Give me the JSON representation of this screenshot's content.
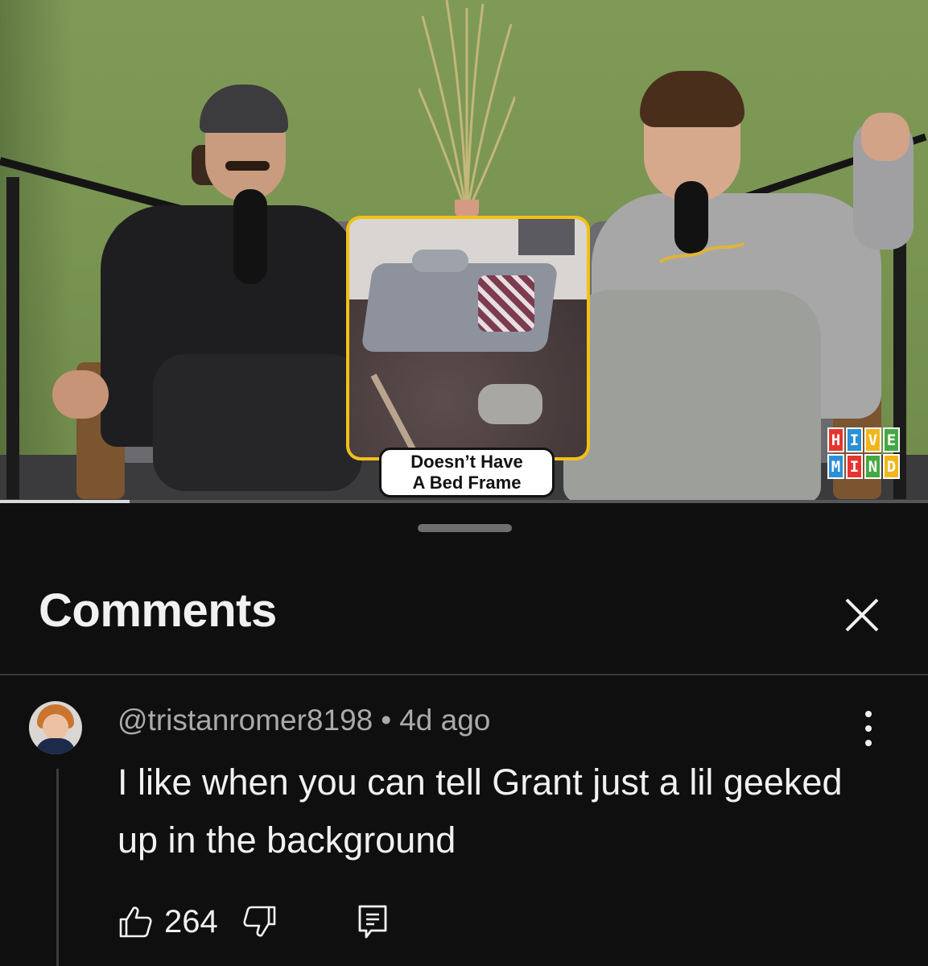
{
  "video": {
    "caption_line1": "Doesn’t Have",
    "caption_line2": "A Bed Frame",
    "watermark_letters": [
      "H",
      "I",
      "V",
      "E",
      "M",
      "I",
      "N",
      "D"
    ],
    "watermark_colors": [
      "#e8342e",
      "#2a8fd6",
      "#f2b51b",
      "#46a843",
      "#2a8fd6",
      "#e8342e",
      "#46a843",
      "#f2b51b"
    ],
    "progress_fraction": 0.14
  },
  "sheet": {
    "title": "Comments",
    "close_icon": "close-icon"
  },
  "comment": {
    "author": "@tristanromer8198",
    "separator": "•",
    "time": "4d ago",
    "text": "I like when you can tell Grant just a lil geeked up in the background",
    "likes": "264",
    "icons": [
      "thumbs-up-icon",
      "thumbs-down-icon",
      "reply-icon",
      "more-vertical-icon"
    ]
  },
  "colors": {
    "background": "#0f0f0f",
    "text_primary": "#f1f1f1",
    "text_secondary": "#aaaaaa",
    "inset_border": "#f2c019"
  }
}
